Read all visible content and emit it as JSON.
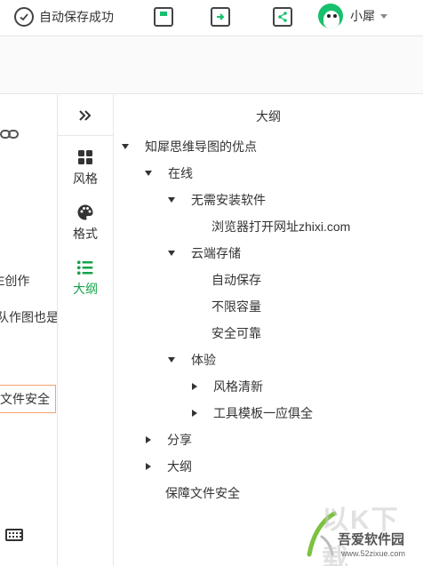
{
  "topbar": {
    "save_status": "自动保存成功",
    "user_name": "小犀"
  },
  "canvas": {
    "fragments": [
      "E创作",
      "队作图也是",
      "文件安全"
    ]
  },
  "sidepanel": {
    "items": [
      {
        "label": "风格",
        "icon": "grid-icon"
      },
      {
        "label": "格式",
        "icon": "palette-icon"
      },
      {
        "label": "大纲",
        "icon": "list-icon",
        "active": true
      }
    ],
    "accent": "#16a34a"
  },
  "outline": {
    "title": "大纲",
    "nodes": [
      {
        "text": "知犀思维导图的优点",
        "level": 0,
        "arrow": "down"
      },
      {
        "text": "在线",
        "level": 1,
        "arrow": "down"
      },
      {
        "text": "无需安装软件",
        "level": 2,
        "arrow": "down"
      },
      {
        "text": "浏览器打开网址zhixi.com",
        "level": 3,
        "arrow": "none"
      },
      {
        "text": "云端存储",
        "level": 2,
        "arrow": "down"
      },
      {
        "text": "自动保存",
        "level": 3,
        "arrow": "none"
      },
      {
        "text": "不限容量",
        "level": 3,
        "arrow": "none"
      },
      {
        "text": "安全可靠",
        "level": 3,
        "arrow": "none"
      },
      {
        "text": "体验",
        "level": 2,
        "arrow": "down"
      },
      {
        "text": "风格清新",
        "level": 3,
        "arrow": "right"
      },
      {
        "text": "工具模板一应俱全",
        "level": 3,
        "arrow": "right"
      },
      {
        "text": "分享",
        "level": 1,
        "arrow": "right"
      },
      {
        "text": "大纲",
        "level": 1,
        "arrow": "right"
      },
      {
        "text": "保障文件安全",
        "level": 1,
        "arrow": "none"
      }
    ]
  },
  "watermark": {
    "big": "以K下载",
    "brand": "吾爱软件园",
    "url": "www.52zixue.com"
  }
}
